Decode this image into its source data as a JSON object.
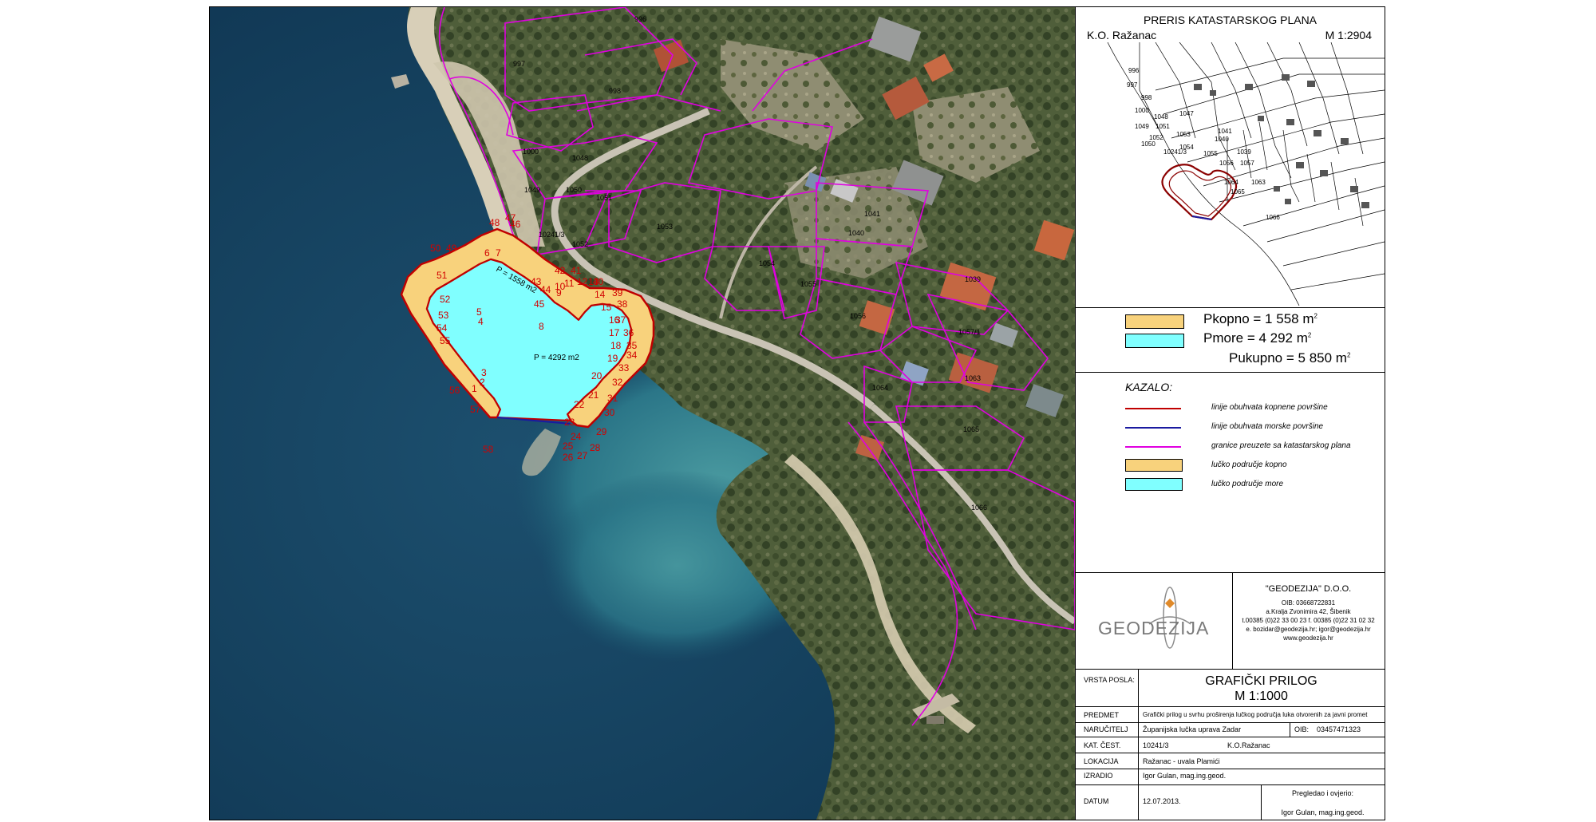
{
  "title_block": {
    "heading": "PRERIS KATASTARSKOG PLANA",
    "ko": "K.O. Ražanac",
    "scale": "M 1:2904"
  },
  "areas": {
    "kopno_label": "Pkopno",
    "kopno_value": "= 1 558 m",
    "more_label": "Pmore",
    "more_value": "= 4 292 m",
    "ukupno_label": "Pukupno",
    "ukupno_value": "= 5 850 m",
    "sup": "2"
  },
  "legend": {
    "title": "KAZALO:",
    "items": [
      {
        "text": "linije obuhvata kopnene površine",
        "color": "#c00000"
      },
      {
        "text": "linije obuhvata morske površine",
        "color": "#1a1aa0"
      },
      {
        "text": "granice preuzete sa katastarskog plana",
        "color": "#e000e0"
      },
      {
        "text": "lučko područje kopno",
        "color": "#f8d27c"
      },
      {
        "text": "lučko područje more",
        "color": "#80ffff"
      }
    ]
  },
  "company": {
    "logo_text": "GEODEZIJA",
    "name": "\"GEODEZIJA\" D.O.O.",
    "lines": [
      "OIB: 03668722831",
      "a.Kralja Zvonimira 42, Šibenik",
      "t.00385 (0)22 33 00 23 f. 00385 (0)22 31 02 32",
      "e. bozidar@geodezija.hr; igor@geodezija.hr",
      "www.geodezija.hr"
    ]
  },
  "info": {
    "vrsta_label": "VRSTA POSLA:",
    "doc_title": "GRAFIČKI PRILOG",
    "doc_scale": "M 1:1000",
    "predmet_label": "PREDMET",
    "predmet_value": "Grafički prilog u svrhu proširenja lučkog područja luka otvorenih za javni promet",
    "narucitelj_label": "NARUČITELJ",
    "narucitelj_value": "Županijska lučka uprava Zadar",
    "oib_label": "OIB:",
    "oib_value": "03457471323",
    "kat_label": "KAT. ČEST.",
    "kat_value": "10241/3",
    "ko_label": "K.O.",
    "ko_value": "Ražanac",
    "lokacija_label": "LOKACIJA",
    "lokacija_value": "Ražanac - uvala Plamići",
    "izradio_label": "IZRADIO",
    "izradio_value": "Igor Gulan, mag.ing.geod.",
    "datum_label": "DATUM",
    "datum_value": "12.07.2013.",
    "pregledao_label": "Pregledao i ovjerio:",
    "pregledao_value": "Igor Gulan, mag.ing.geod."
  },
  "map": {
    "area_land": "P = 1558 m2",
    "area_sea": "P = 4292 m2",
    "parcel_label": "10241/3",
    "parcels": [
      "996",
      "997",
      "998",
      "1000",
      "1048",
      "1049",
      "1050",
      "1051",
      "1052",
      "1053",
      "1041",
      "1040",
      "1054",
      "1055",
      "1056",
      "1039",
      "1057/1",
      "1063",
      "1064",
      "1065",
      "1066"
    ],
    "points": [
      "1",
      "2",
      "3",
      "4",
      "5",
      "6",
      "7",
      "8",
      "9",
      "10",
      "11",
      "12",
      "13",
      "14",
      "15",
      "16",
      "17",
      "18",
      "19",
      "20",
      "21",
      "22",
      "23",
      "24",
      "25",
      "26",
      "27",
      "28",
      "29",
      "30",
      "31",
      "32",
      "33",
      "34",
      "35",
      "36",
      "37",
      "38",
      "39",
      "40",
      "41",
      "42",
      "43",
      "44",
      "45",
      "46",
      "47",
      "48",
      "49",
      "50",
      "51",
      "52",
      "53",
      "54",
      "55",
      "56",
      "57",
      "58"
    ]
  },
  "inset": {
    "parcels": [
      "996",
      "997",
      "998",
      "1000",
      "1048",
      "1047",
      "1049",
      "1051",
      "1052",
      "1053",
      "1041",
      "1040",
      "1054",
      "1055",
      "1056",
      "1039",
      "1057",
      "1063",
      "1064",
      "1065",
      "1066",
      "10241/3",
      "1050"
    ]
  }
}
